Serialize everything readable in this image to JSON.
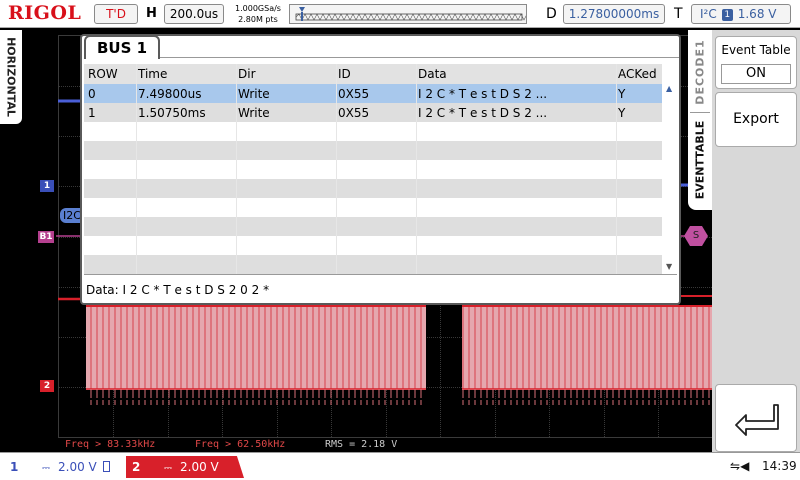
{
  "topbar": {
    "brand": "RIGOL",
    "trigger_status": "T'D",
    "h_label": "H",
    "timebase": "200.0us",
    "sample_rate": "1.000GSa/s",
    "memory_depth": "2.80M pts",
    "d_label": "D",
    "delay": "1.27800000ms",
    "t_label": "T",
    "trigger_source": "I²C",
    "trigger_badge": "1",
    "trigger_level": "1.68 V"
  },
  "left_tab": {
    "label": "HORIZONTAL"
  },
  "markers": {
    "ch1": "1",
    "bus1": "B1",
    "ch2": "2",
    "bus_label": "I2C",
    "bus_symbol": "S"
  },
  "bus_window": {
    "title": "BUS 1",
    "columns": [
      "ROW",
      "Time",
      "Dir",
      "ID",
      "Data",
      "ACKed"
    ],
    "rows": [
      {
        "row": "0",
        "time": "7.49800us",
        "dir": "Write",
        "id": "0X55",
        "data": "I 2 C * T e s t D S 2 ...",
        "acked": "Y"
      },
      {
        "row": "1",
        "time": "1.50750ms",
        "dir": "Write",
        "id": "0X55",
        "data": "I 2 C * T e s t D S 2 ...",
        "acked": "Y"
      }
    ],
    "detail": "Data: I 2 C * T e s t D S 2 0 2 *"
  },
  "right_tabs": {
    "decode": "DECODE1",
    "event": "EVENTTABLE"
  },
  "menu": {
    "event_table_label": "Event Table",
    "event_table_value": "ON",
    "export_label": "Export"
  },
  "measurements": {
    "freq1": "Freq > 83.33kHz",
    "freq2": "Freq > 62.50kHz",
    "rms": "RMS = 2.18 V"
  },
  "bottombar": {
    "ch1_num": "1",
    "ch1_scale": "2.00 V",
    "ch2_num": "2",
    "ch2_scale": "2.00 V",
    "coupling_symbol": "⎓",
    "usb_symbol": "⇋",
    "speaker_symbol": "◀",
    "clock": "14:39"
  },
  "colors": {
    "brand_red": "#d8101a",
    "ch1": "#3a4fb8",
    "ch2": "#d8202a",
    "bus": "#b5408f",
    "selection": "#a8c8ec"
  }
}
